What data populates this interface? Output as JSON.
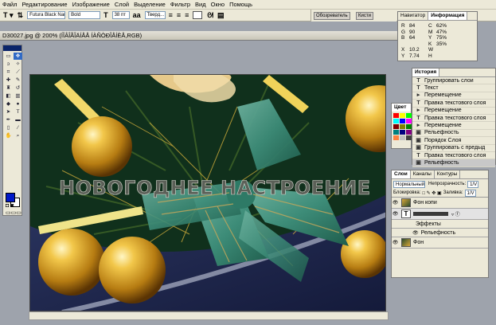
{
  "menu": [
    "Файл",
    "Редактирование",
    "Изображение",
    "Слой",
    "Выделение",
    "Фильтр",
    "Вид",
    "Окно",
    "Помощь"
  ],
  "options": {
    "font": "Futura Black Narr...",
    "style": "Bold",
    "size": "38 пт",
    "aa": "Тверд..."
  },
  "well_tabs": [
    "Обозреватель",
    "Кисти"
  ],
  "document": {
    "title": "D30027.jpg @ 200% (ÍÎÂÎÃÎÄÍÅÅ ÍÀÑÒÐÎÅÍÈÅ,RGB)",
    "text_overlay": "НОВОГОДНЕЕ НАСТРОЕНИЕ"
  },
  "navigator": {
    "tabs": [
      "Навигатор",
      "Информация"
    ],
    "rgb": [
      [
        "R",
        "84"
      ],
      [
        "G",
        "90"
      ],
      [
        "B",
        "64"
      ]
    ],
    "cmyk": [
      [
        "C",
        "62%"
      ],
      [
        "M",
        "47%"
      ],
      [
        "Y",
        "75%"
      ],
      [
        "K",
        "35%"
      ]
    ],
    "coords": [
      [
        "X",
        "10.2"
      ],
      [
        "Y",
        "7.74"
      ]
    ],
    "wh": [
      [
        "W",
        ""
      ],
      [
        "H",
        ""
      ]
    ]
  },
  "history": {
    "tab": "История",
    "items": [
      {
        "icon": "T",
        "label": "Группировать слои"
      },
      {
        "icon": "T",
        "label": "Текст"
      },
      {
        "icon": "▸",
        "label": "Перемещение"
      },
      {
        "icon": "T",
        "label": "Правка текстового слоя"
      },
      {
        "icon": "▸",
        "label": "Перемещение"
      },
      {
        "icon": "T",
        "label": "Правка текстового слоя"
      },
      {
        "icon": "▸",
        "label": "Перемещение"
      },
      {
        "icon": "▣",
        "label": "Рельефность"
      },
      {
        "icon": "▣",
        "label": "Порядок Слоя"
      },
      {
        "icon": "▣",
        "label": "Группировать с предыд"
      },
      {
        "icon": "T",
        "label": "Правка текстового слоя"
      },
      {
        "icon": "▣",
        "label": "Рельефность"
      }
    ]
  },
  "color_panel": {
    "tab": "Цвет"
  },
  "layers": {
    "tabs": [
      "Слои",
      "Каналы",
      "Контуры"
    ],
    "blend_mode": "Нормальный",
    "opacity_label": "Непрозрачность:",
    "opacity_value": "1/V",
    "lock_label": "Блокировка:",
    "fill_label": "Заливка:",
    "fill_value": "1/V",
    "rows": [
      {
        "name": "Фон копи",
        "type": "image"
      },
      {
        "name": "",
        "type": "text"
      },
      {
        "name": "Эффекты",
        "type": "fx"
      },
      {
        "name": "Рельефность",
        "type": "effect"
      },
      {
        "name": "Фон",
        "type": "image"
      }
    ]
  }
}
